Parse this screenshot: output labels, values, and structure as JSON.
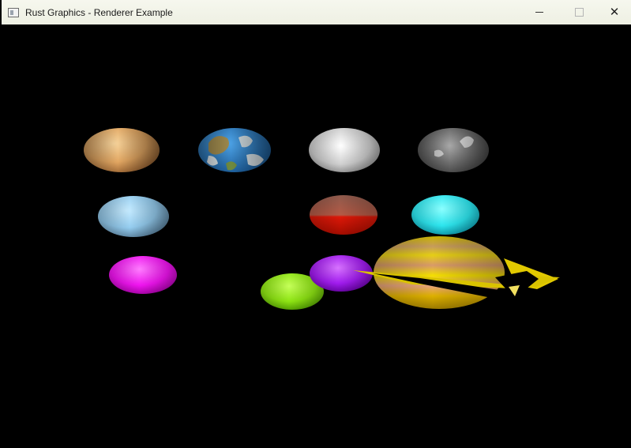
{
  "window": {
    "title": "Rust Graphics - Renderer Example",
    "controls": {
      "minimize": "minimize-icon",
      "maximize": "maximize-icon",
      "close": "close-icon"
    }
  },
  "scene": {
    "background": "#000000",
    "planets": [
      {
        "name": "planet-mercury",
        "colors": [
          "#f1c07c",
          "#c38a4c"
        ]
      },
      {
        "name": "planet-earth",
        "colors": [
          "#2f7fc9",
          "#a3844f"
        ]
      },
      {
        "name": "planet-moon-white",
        "colors": [
          "#f0f0f0",
          "#8e8e8e"
        ]
      },
      {
        "name": "planet-gray",
        "colors": [
          "#9d9d9d",
          "#4f4f4f"
        ]
      },
      {
        "name": "planet-light-blue",
        "colors": [
          "#a6dcff",
          "#5b8bad"
        ]
      },
      {
        "name": "planet-mars",
        "colors": [
          "#b05f4a",
          "#e21606"
        ]
      },
      {
        "name": "planet-cyan",
        "colors": [
          "#42f3f3",
          "#07a8bb"
        ]
      },
      {
        "name": "planet-magenta",
        "colors": [
          "#ff3cff",
          "#b900b9"
        ]
      },
      {
        "name": "planet-lime",
        "colors": [
          "#a1ff2a",
          "#5bb000"
        ]
      },
      {
        "name": "planet-purple",
        "colors": [
          "#c43cff",
          "#7a00c0"
        ]
      },
      {
        "name": "planet-saturn",
        "colors": [
          "#f0d700",
          "#d08563"
        ]
      }
    ]
  }
}
